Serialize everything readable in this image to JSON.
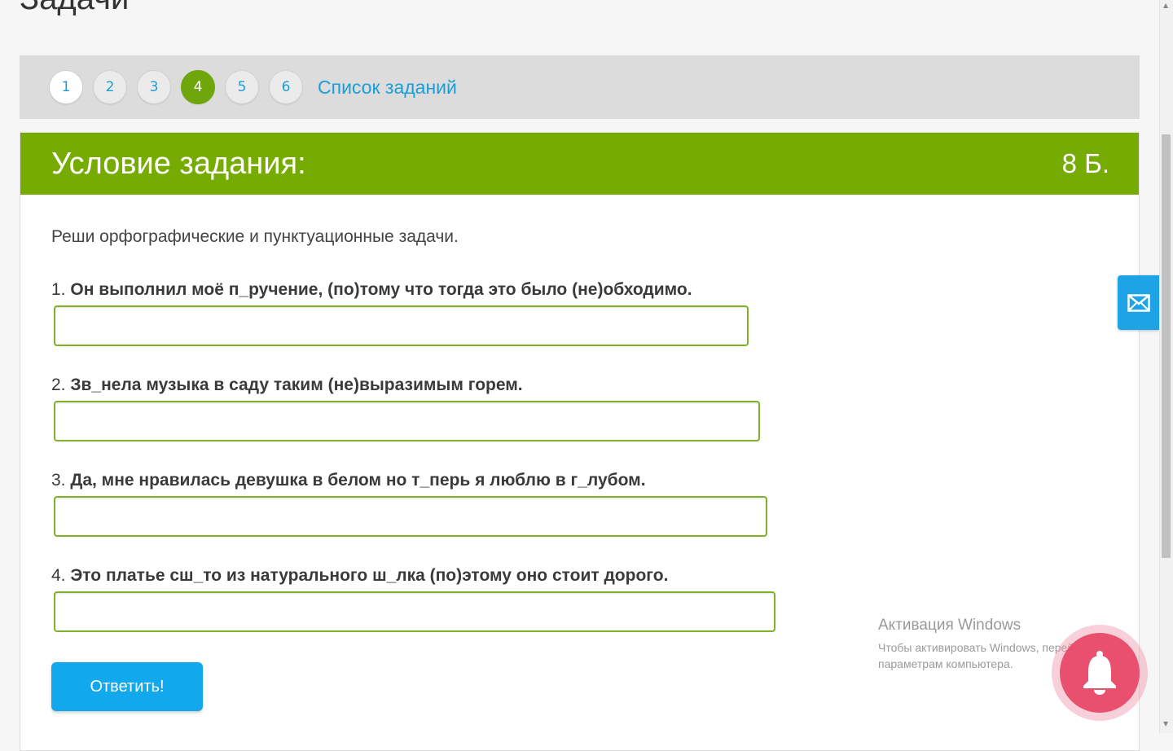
{
  "page": {
    "title": "Задачи"
  },
  "pager": {
    "numbers": [
      "1",
      "2",
      "3",
      "4",
      "5",
      "6"
    ],
    "active_index": 3,
    "list_link": "Список заданий"
  },
  "task": {
    "header_title": "Условие задания:",
    "points": "8 Б.",
    "instruction": "Реши орфографические и пунктуационные задачи.",
    "questions": [
      {
        "num": "1.",
        "text": "Он выполнил моё п_ручение, (по)тому что тогда это было (не)обходимо.",
        "answer": ""
      },
      {
        "num": "2.",
        "text": "Зв_нела музыка в саду таким (не)выразимым горем.",
        "answer": ""
      },
      {
        "num": "3.",
        "text": "Да, мне нравилась девушка в белом но т_перь я люблю в г_лубом.",
        "answer": ""
      },
      {
        "num": "4.",
        "text": "Это платье сш_то из натурального ш_лка (по)этому оно стоит дорого.",
        "answer": ""
      }
    ],
    "submit_label": "Ответить!"
  },
  "watermark": {
    "title": "Активация Windows",
    "line1": "Чтобы активировать Windows, перейдите к",
    "line2": "параметрам компьютера."
  },
  "colors": {
    "accent_green": "#76ab02",
    "link_blue": "#1a9ed8",
    "button_blue": "#12a8ee",
    "bell_pink": "#e8506e"
  },
  "icons": {
    "mail": "mail-icon",
    "bell": "bell-icon"
  }
}
